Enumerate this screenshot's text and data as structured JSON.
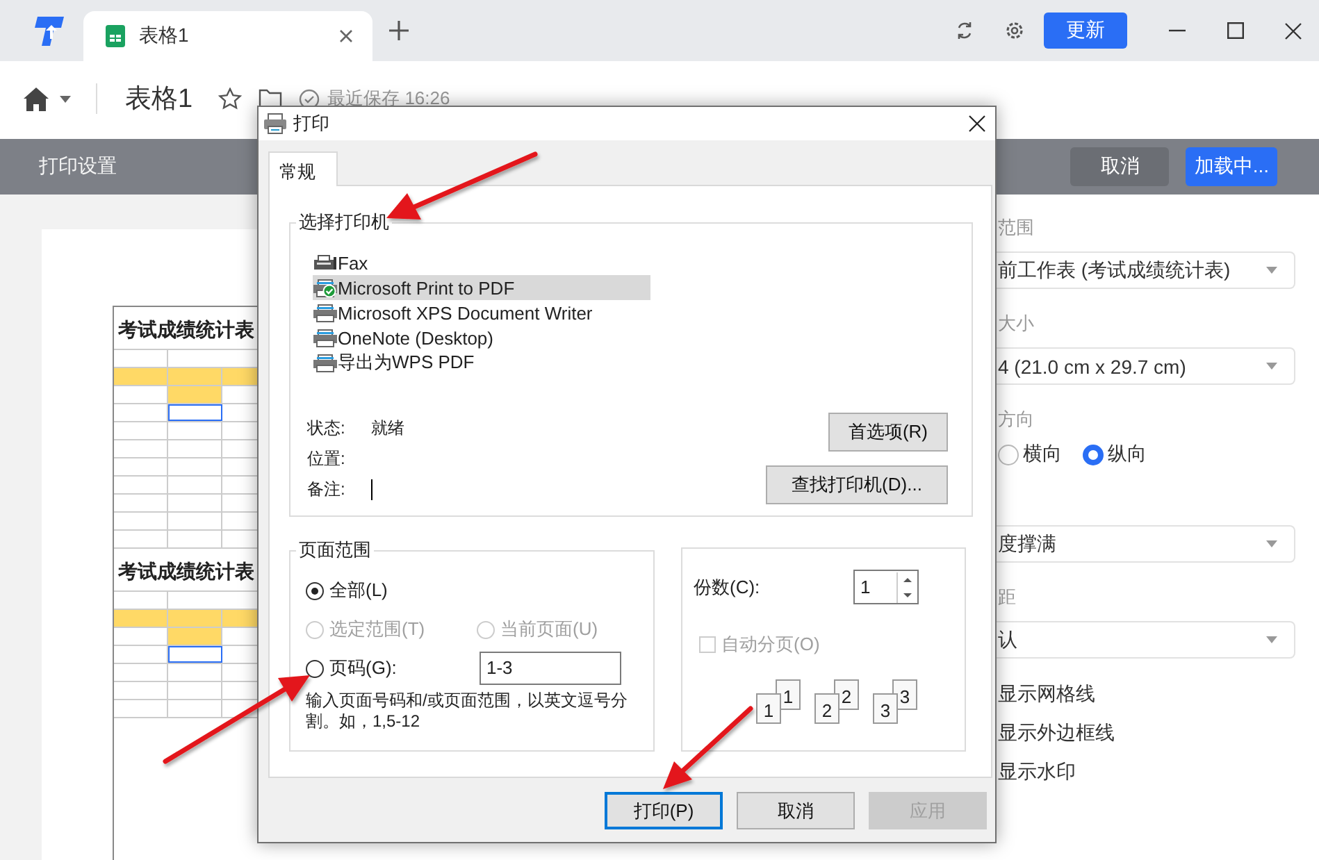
{
  "app_tabs": [
    {
      "label": "表格1",
      "selected": true
    }
  ],
  "update_button": "更新",
  "doc_bar": {
    "title": "表格1",
    "save_status": "最近保存 16:26"
  },
  "print_bar": {
    "title": "打印设置",
    "cancel": "取消",
    "confirm": "加载中..."
  },
  "preview": {
    "blocks": [
      {
        "title": "考试成绩统计表",
        "kind": "full"
      },
      {
        "title": "考试成绩统计表",
        "kind": "partial"
      }
    ]
  },
  "settings": [
    {
      "kind": "label",
      "text": "范围"
    },
    {
      "kind": "select",
      "value": "前工作表 (考试成绩统计表)"
    },
    {
      "kind": "label",
      "text": "大小"
    },
    {
      "kind": "select",
      "value": "4 (21.0 cm x 29.7 cm)"
    },
    {
      "kind": "label",
      "text": "方向"
    },
    {
      "kind": "radios",
      "options": [
        {
          "label": "横向",
          "selected": false
        },
        {
          "label": "纵向",
          "selected": true
        }
      ]
    },
    {
      "kind": "select",
      "value": "度撑满"
    },
    {
      "kind": "label",
      "text": "距"
    },
    {
      "kind": "select",
      "value": "认"
    },
    {
      "kind": "option",
      "text": "显示网格线"
    },
    {
      "kind": "option",
      "text": "显示外边框线"
    },
    {
      "kind": "option",
      "text": "显示水印"
    }
  ],
  "dialog": {
    "title": "打印",
    "tabs": [
      {
        "label": "常规",
        "selected": true
      }
    ],
    "printer_group": "选择打印机",
    "printers": [
      {
        "name": "Fax",
        "kind": "fax",
        "selected": false,
        "default": false
      },
      {
        "name": "Microsoft Print to PDF",
        "kind": "printer",
        "selected": true,
        "default": true
      },
      {
        "name": "Microsoft XPS Document Writer",
        "kind": "printer",
        "selected": false,
        "default": false
      },
      {
        "name": "OneNote (Desktop)",
        "kind": "printer",
        "selected": false,
        "default": false
      },
      {
        "name": "导出为WPS PDF",
        "kind": "printer",
        "selected": false,
        "default": false
      }
    ],
    "info": [
      {
        "label": "状态:",
        "value": "就绪",
        "caret": false
      },
      {
        "label": "位置:",
        "caret": false
      },
      {
        "label": "备注:",
        "caret": true
      }
    ],
    "printer_buttons": [
      "首选项(R)",
      "查找打印机(D)..."
    ],
    "range_group": "页面范围",
    "range_options": [
      {
        "label": "全部(L)",
        "selected": true,
        "disabled": false
      },
      {
        "label": "选定范围(T)",
        "selected": false,
        "disabled": true
      },
      {
        "label": "当前页面(U)",
        "selected": false,
        "disabled": true
      },
      {
        "label": "页码(G):",
        "selected": false,
        "disabled": false
      }
    ],
    "page_input": "1-3",
    "range_hint": "输入页面号码和/或页面范围，以英文逗号分割。如，1,5-12",
    "copies_label": "份数(C):",
    "copies": "1",
    "collate": {
      "label": "自动分页(O)",
      "checked": false,
      "disabled": true
    },
    "collate_pages": [
      [
        "1",
        "1"
      ],
      [
        "2",
        "2"
      ],
      [
        "3",
        "3"
      ]
    ],
    "buttons": [
      {
        "label": "打印(P)",
        "default": true,
        "disabled": false
      },
      {
        "label": "取消",
        "default": false,
        "disabled": false
      },
      {
        "label": "应用",
        "default": false,
        "disabled": true
      }
    ]
  }
}
